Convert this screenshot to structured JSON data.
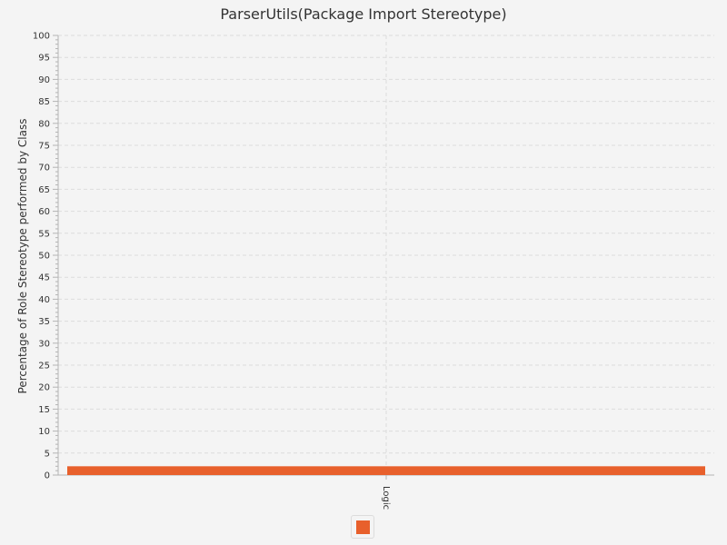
{
  "chart_data": {
    "type": "bar",
    "title": "ParserUtils(Package Import Stereotype)",
    "xlabel": "",
    "ylabel": "Percentage of Role Stereotype performed by Class",
    "categories": [
      "Logic"
    ],
    "series": [
      {
        "values": [
          2
        ],
        "color": "#e8602c"
      }
    ],
    "ylim": [
      0,
      100
    ],
    "y_tick_step": 5,
    "grid": true,
    "legend": "bottom-center"
  }
}
